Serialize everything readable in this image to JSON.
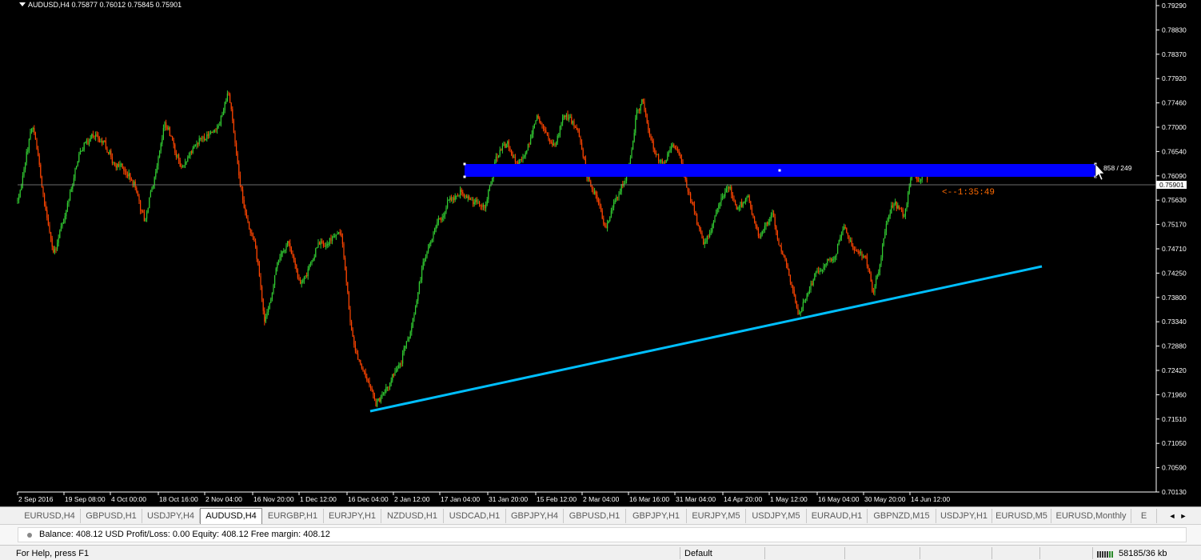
{
  "chart": {
    "header": "AUDUSD,H4  0.75877 0.76012 0.75845 0.75901",
    "price_scale": [
      "0.79290",
      "0.78830",
      "0.78370",
      "0.77920",
      "0.77460",
      "0.77000",
      "0.76540",
      "0.76090",
      "0.75630",
      "0.75170",
      "0.74710",
      "0.74250",
      "0.73800",
      "0.73340",
      "0.72880",
      "0.72420",
      "0.71960",
      "0.71510",
      "0.71050",
      "0.70590",
      "0.70130"
    ],
    "current_price": "0.75901",
    "time_scale": [
      "2 Sep 2016",
      "19 Sep 08:00",
      "4 Oct 00:00",
      "18 Oct 16:00",
      "2 Nov 04:00",
      "16 Nov 20:00",
      "1 Dec 12:00",
      "16 Dec 04:00",
      "2 Jan 12:00",
      "17 Jan 04:00",
      "31 Jan 20:00",
      "15 Feb 12:00",
      "2 Mar 04:00",
      "16 Mar 16:00",
      "31 Mar 04:00",
      "14 Apr 20:00",
      "1 May 12:00",
      "16 May 04:00",
      "30 May 20:00",
      "14 Jun 12:00"
    ],
    "rectangle_label": "858 / 249",
    "countdown": "<--1:35:49",
    "colors": {
      "background": "#000000",
      "bull_candle": "#32CD32",
      "bear_candle": "#FF4500",
      "zone": "#0000FF",
      "trendline": "#00BFFF",
      "countdown": "#FF6A00"
    }
  },
  "tabs": [
    {
      "label": "EURUSD,H4",
      "active": false
    },
    {
      "label": "GBPUSD,H1",
      "active": false
    },
    {
      "label": "USDJPY,H4",
      "active": false
    },
    {
      "label": "AUDUSD,H4",
      "active": true
    },
    {
      "label": "EURGBP,H1",
      "active": false
    },
    {
      "label": "EURJPY,H1",
      "active": false
    },
    {
      "label": "NZDUSD,H1",
      "active": false
    },
    {
      "label": "USDCAD,H1",
      "active": false
    },
    {
      "label": "GBPJPY,H4",
      "active": false
    },
    {
      "label": "GBPUSD,H1",
      "active": false
    },
    {
      "label": "GBPJPY,H1",
      "active": false
    },
    {
      "label": "EURJPY,M5",
      "active": false
    },
    {
      "label": "USDJPY,M5",
      "active": false
    },
    {
      "label": "EURAUD,H1",
      "active": false
    },
    {
      "label": "GBPNZD,M15",
      "active": false
    },
    {
      "label": "USDJPY,H1",
      "active": false
    },
    {
      "label": "EURUSD,M5",
      "active": false
    },
    {
      "label": "EURUSD,Monthly",
      "active": false
    },
    {
      "label": "E",
      "active": false
    }
  ],
  "balance": {
    "text": "Balance: 408.12 USD  Profit/Loss: 0.00  Equity: 408.12  Free margin: 408.12"
  },
  "status": {
    "help": "For Help, press F1",
    "profile": "Default",
    "traffic": "58185/36 kb"
  }
}
